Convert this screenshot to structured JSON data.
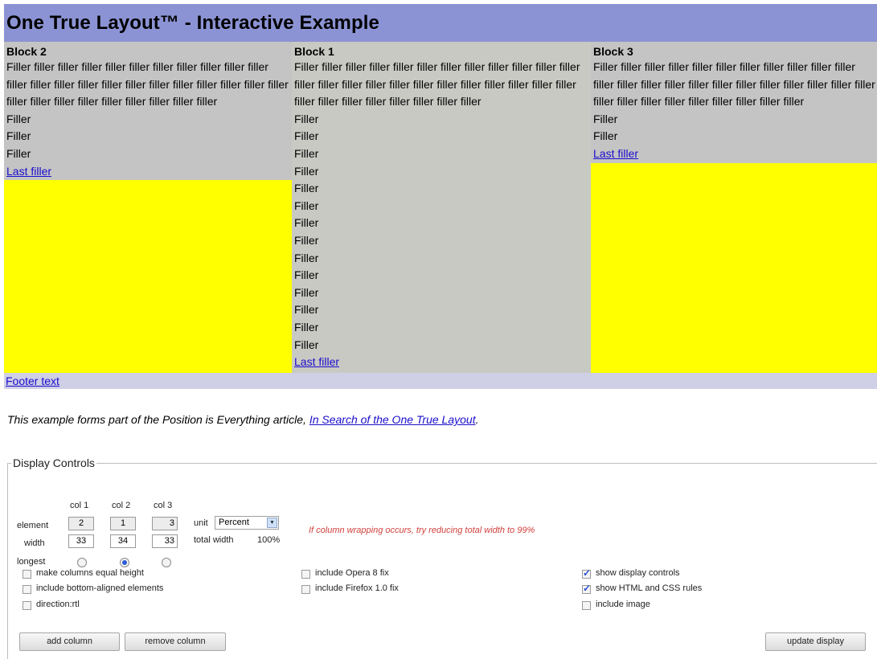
{
  "header": {
    "title": "One True Layout™ - Interactive Example"
  },
  "columns": {
    "block2": {
      "title": "Block 2",
      "text": "Filler filler filler filler filler filler filler filler filler filler filler filler filler filler filler filler filler filler filler filler filler filler filler filler filler filler filler filler filler filler filler filler",
      "lines": [
        "Filler",
        "Filler",
        "Filler"
      ],
      "link": "Last filler"
    },
    "block1": {
      "title": "Block 1",
      "text": "Filler filler filler filler filler filler filler filler filler filler filler filler filler filler filler filler filler filler filler filler filler filler filler filler filler filler filler filler filler filler filler filler",
      "lines": [
        "Filler",
        "Filler",
        "Filler",
        "Filler",
        "Filler",
        "Filler",
        "Filler",
        "Filler",
        "Filler",
        "Filler",
        "Filler",
        "Filler",
        "Filler",
        "Filler"
      ],
      "link": "Last filler"
    },
    "block3": {
      "title": "Block 3",
      "text": "Filler filler filler filler filler filler filler filler filler filler filler filler filler filler filler filler filler filler filler filler filler filler filler filler filler filler filler filler filler filler filler filler",
      "lines": [
        "Filler",
        "Filler"
      ],
      "link": "Last filler"
    }
  },
  "footer": {
    "link": "Footer text"
  },
  "intro": {
    "text": "This example forms part of the Position is Everything article, ",
    "link": "In Search of the One True Layout",
    "end": "."
  },
  "controls": {
    "legend": "Display Controls",
    "col_headers": [
      "col 1",
      "col 2",
      "col 3"
    ],
    "row_labels": {
      "element": "element",
      "width": "width",
      "longest": "longest"
    },
    "element_values": [
      "2",
      "1",
      "3"
    ],
    "width_values": [
      "33",
      "34",
      "33"
    ],
    "longest_selected": 2,
    "unit_label": "unit",
    "unit_value": "Percent",
    "total_width_label": "total width",
    "total_width_value": "100%",
    "warning": "If column wrapping occurs, try reducing total width to 99%",
    "checkboxes": {
      "equal_height": {
        "label": "make columns equal height",
        "checked": false
      },
      "bottom_aligned": {
        "label": "include bottom-aligned elements",
        "checked": false
      },
      "rtl": {
        "label": "direction:rtl",
        "checked": false
      },
      "opera_fix": {
        "label": "include Opera 8 fix",
        "checked": false
      },
      "firefox_fix": {
        "label": "include Firefox 1.0 fix",
        "checked": false
      },
      "show_controls": {
        "label": "show display controls",
        "checked": true
      },
      "show_rules": {
        "label": "show HTML and CSS rules",
        "checked": true
      },
      "include_image": {
        "label": "include image",
        "checked": false
      }
    },
    "buttons": {
      "add": "add column",
      "remove": "remove column",
      "update": "update display"
    }
  },
  "colors": {
    "header_bg": "#8c93d4",
    "column_bg": "#c9c9c9",
    "fill_bg": "#ffff00",
    "footer_bg": "#cfcfe6",
    "link": "#1a0dcc",
    "warning": "#d0413c"
  }
}
